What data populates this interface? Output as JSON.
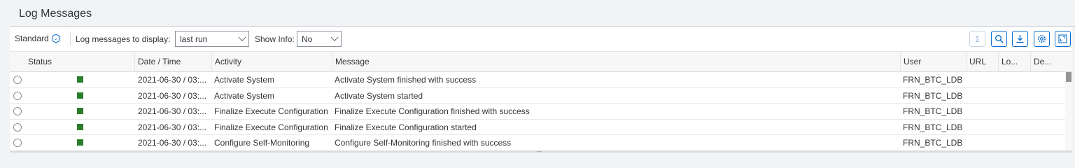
{
  "panel": {
    "title": "Log Messages"
  },
  "toolbar": {
    "variant_label": "Standard",
    "variant_icon": "chevron-down-circle-icon",
    "log_label": "Log messages to display:",
    "log_value": "last run",
    "info_label": "Show Info:",
    "info_value": "No",
    "buttons": [
      "sum-icon",
      "search-icon",
      "download-icon",
      "settings-icon",
      "fullscreen-icon"
    ]
  },
  "table": {
    "columns": [
      "Status",
      "Date / Time",
      "Activity",
      "Message",
      "User",
      "URL",
      "Lo...",
      "De..."
    ],
    "rows": [
      {
        "status": "success",
        "datetime": "2021-06-30 / 03:...",
        "activity": "Activate System",
        "message": "Activate System finished with success",
        "user": "FRN_BTC_LDB"
      },
      {
        "status": "success",
        "datetime": "2021-06-30 / 03:...",
        "activity": "Activate System",
        "message": "Activate System started",
        "user": "FRN_BTC_LDB"
      },
      {
        "status": "success",
        "datetime": "2021-06-30 / 03:...",
        "activity": "Finalize Execute Configuration",
        "message": "Finalize Execute Configuration finished with success",
        "user": "FRN_BTC_LDB"
      },
      {
        "status": "success",
        "datetime": "2021-06-30 / 03:...",
        "activity": "Finalize Execute Configuration",
        "message": "Finalize Execute Configuration started",
        "user": "FRN_BTC_LDB"
      },
      {
        "status": "success",
        "datetime": "2021-06-30 / 03:...",
        "activity": "Configure Self-Monitoring",
        "message": "Configure Self-Monitoring finished with success",
        "user": "FRN_BTC_LDB"
      }
    ]
  },
  "colors": {
    "accent": "#0a6ed1",
    "success": "#2b7c2b",
    "background": "#f1f3f5"
  }
}
